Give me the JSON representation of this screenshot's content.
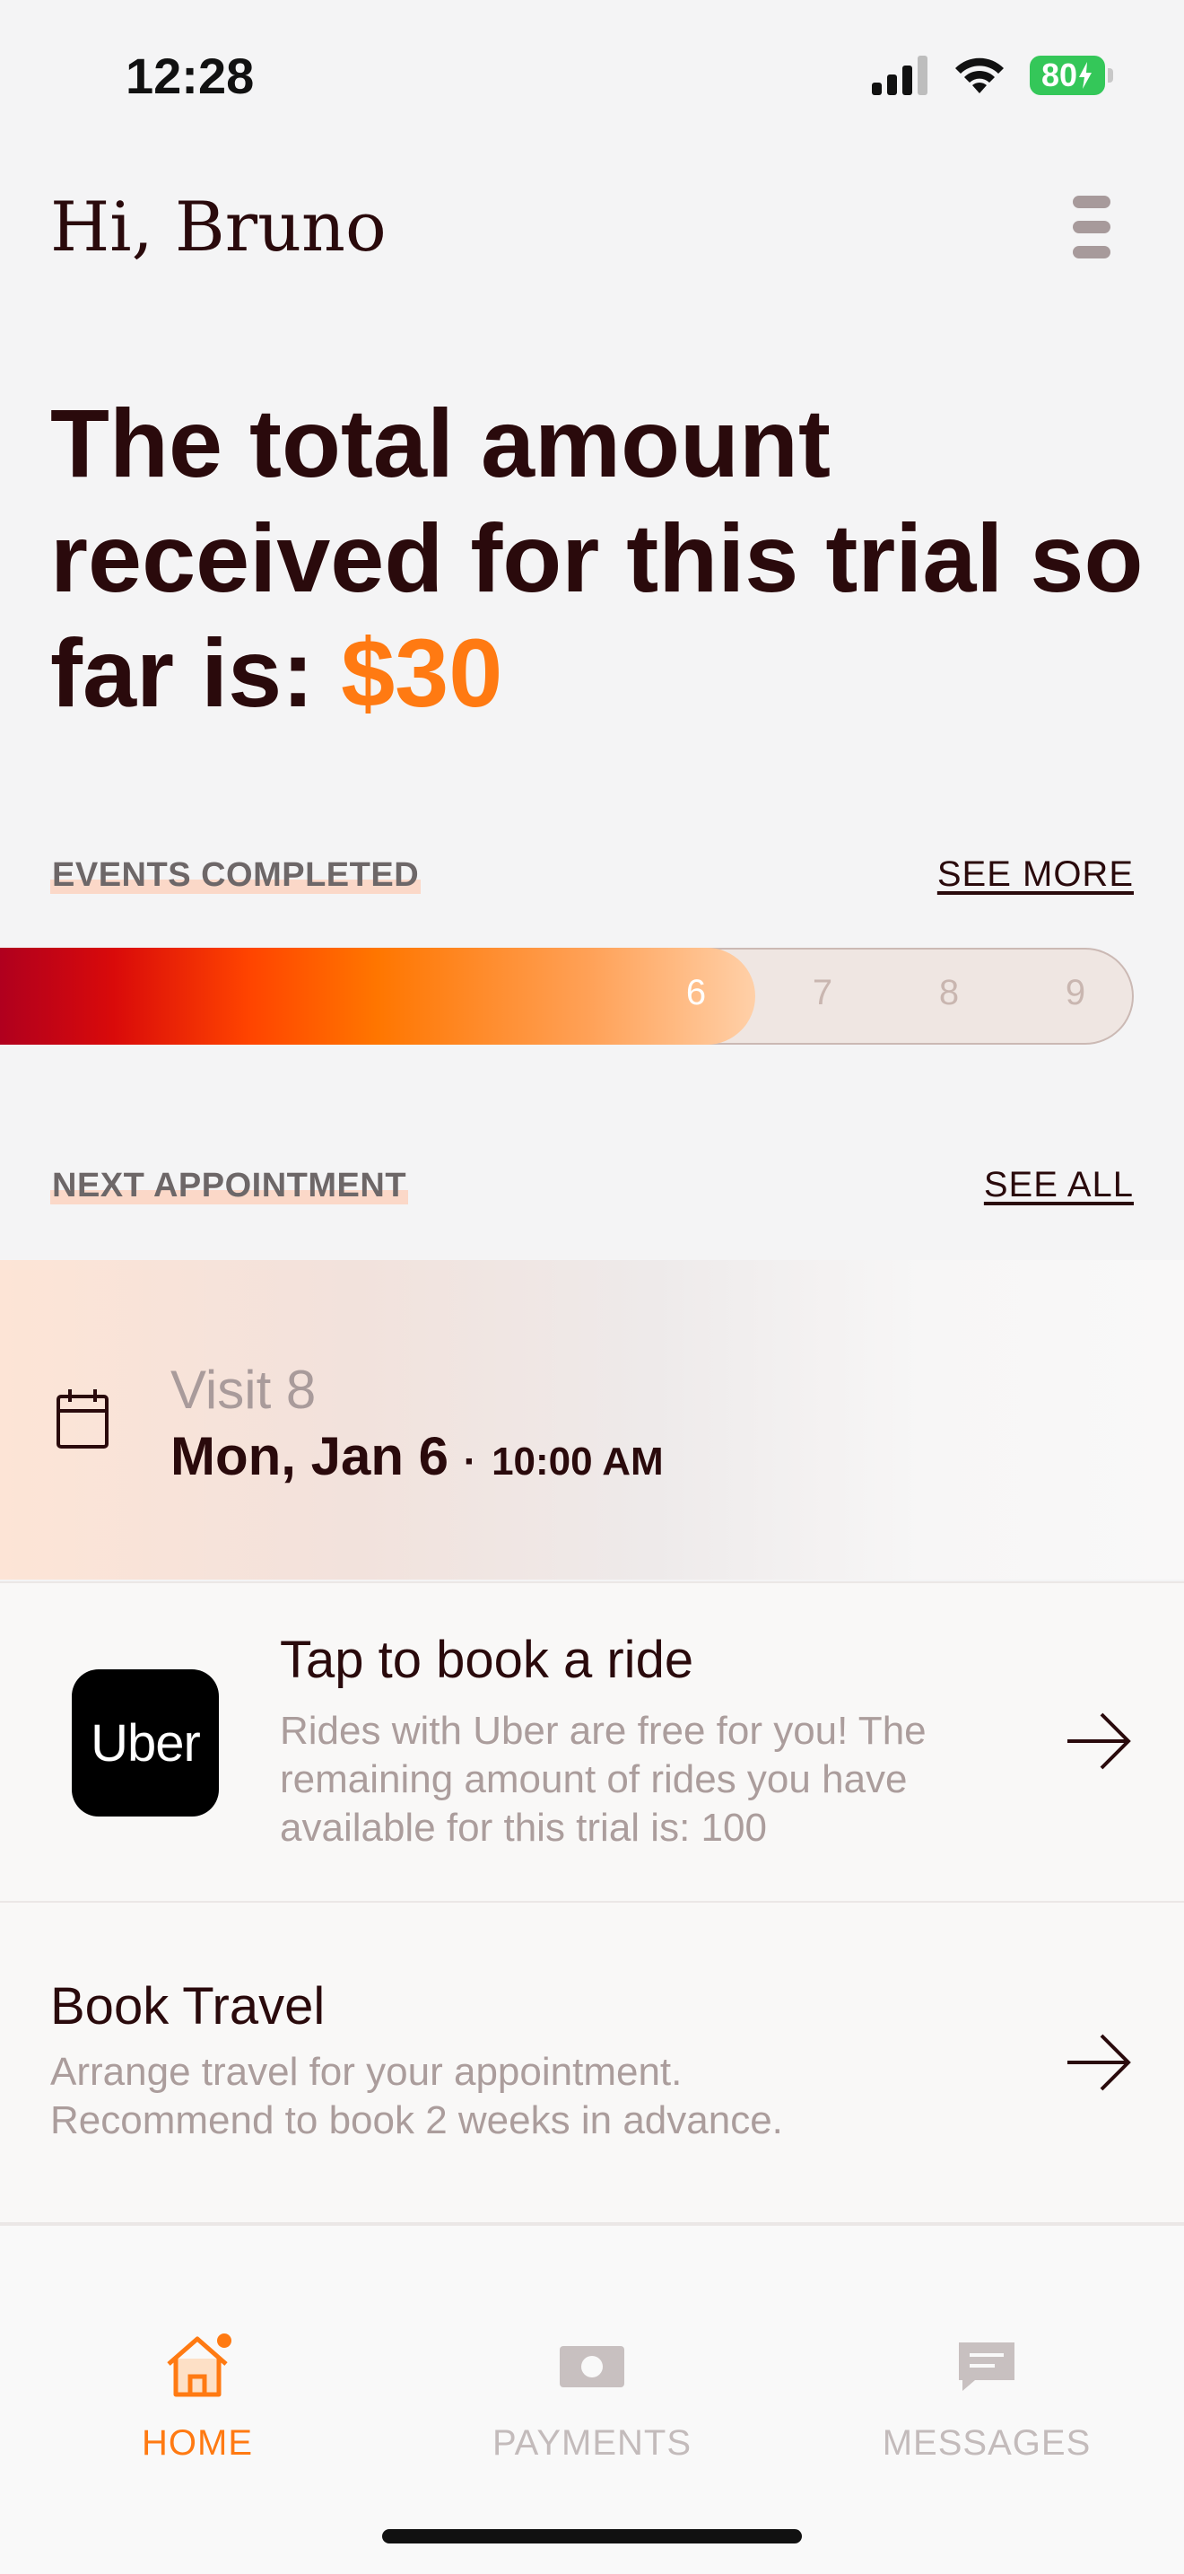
{
  "status_bar": {
    "time": "12:28",
    "battery": "80"
  },
  "header": {
    "greeting": "Hi, Bruno"
  },
  "summary": {
    "text": "The total amount received for this trial so far is: ",
    "amount": "$30"
  },
  "events": {
    "label": "EVENTS COMPLETED",
    "link": "SEE MORE",
    "completed": 6,
    "total": 9,
    "numbers": [
      "6",
      "7",
      "8",
      "9"
    ]
  },
  "appointment": {
    "label": "NEXT APPOINTMENT",
    "link": "SEE ALL",
    "visit": "Visit 8",
    "date": "Mon, Jan 6",
    "separator": "·",
    "time": "10:00 AM"
  },
  "ride": {
    "logo": "Uber",
    "title": "Tap to book a ride",
    "description": "Rides with Uber are free for you! The remaining amount of rides you have available for this trial is: 100"
  },
  "travel": {
    "title": "Book Travel",
    "description": "Arrange travel for your appointment. Recommend to book 2 weeks in advance."
  },
  "tabs": [
    {
      "label": "HOME",
      "icon": "home-icon",
      "active": true
    },
    {
      "label": "PAYMENTS",
      "icon": "payments-icon",
      "active": false
    },
    {
      "label": "MESSAGES",
      "icon": "messages-icon",
      "active": false
    }
  ],
  "colors": {
    "accent": "#ff7a12",
    "text": "#2a0a0c",
    "muted": "#ab9d9c",
    "tab_inactive": "#c3bbbb"
  }
}
